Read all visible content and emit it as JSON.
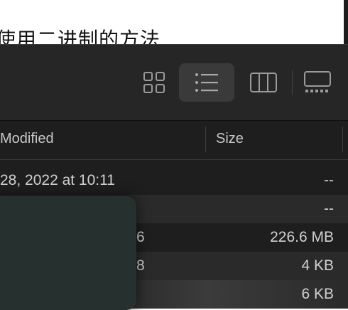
{
  "document": {
    "text": "使用二进制的方法"
  },
  "toolbar": {
    "views": [
      {
        "name": "icon-view",
        "active": false
      },
      {
        "name": "list-view",
        "active": true
      },
      {
        "name": "column-view",
        "active": false
      },
      {
        "name": "gallery-view",
        "active": false
      }
    ]
  },
  "columns": {
    "modified": "Modified",
    "size": "Size"
  },
  "rows": [
    {
      "modified": "28, 2022 at 10:11",
      "size": "--"
    },
    {
      "modified": ")",
      "size": "--"
    },
    {
      "modified": "6",
      "size": "226.6 MB"
    },
    {
      "modified": "8",
      "size": "4 KB"
    },
    {
      "modified": "",
      "size": "6 KB"
    }
  ],
  "colors": {
    "window_bg": "#1e1e1e",
    "toolbar_bg": "#262626",
    "active_view_bg": "#3a3a3a",
    "overlay_bg": "#26302f"
  }
}
